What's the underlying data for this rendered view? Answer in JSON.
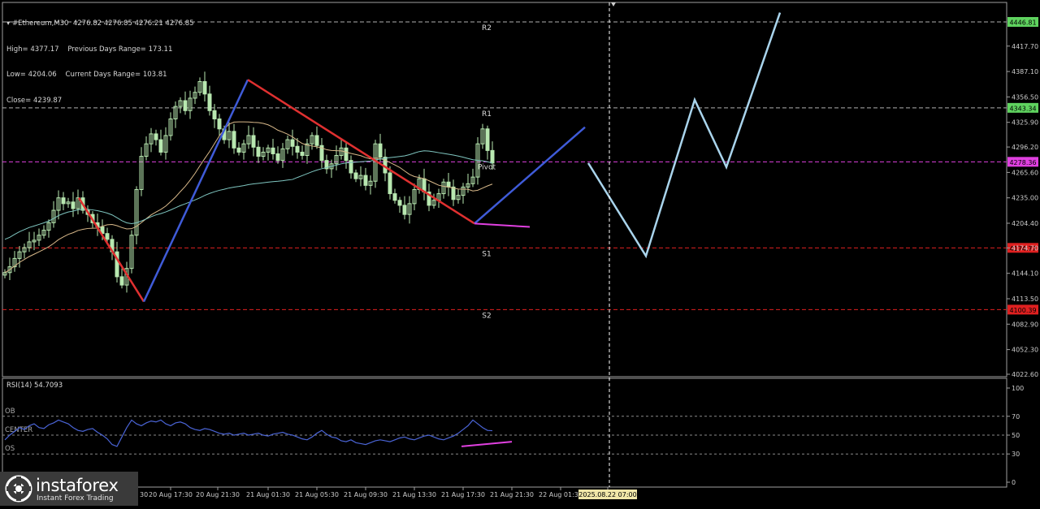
{
  "header": {
    "symbol_line": "#Ethereum,M30  4276.82 4276.85 4276.21 4276.85",
    "high": "High= 4377.17",
    "prev_range": "Previous Days Range= 173.11",
    "low": "Low= 4204.06",
    "curr_range": "Current Days Range= 103.81",
    "close": "Close= 4239.87"
  },
  "branding": {
    "name": "instaforex",
    "tagline": "Instant Forex Trading"
  },
  "colors": {
    "background": "#000000",
    "bull_candle": "#b8e8b0",
    "bear_candle": "#b8e8b0",
    "ma_fast": "#d9b98a",
    "ma_slow": "#7fc6c0",
    "zigzag_up": "#3f5bd8",
    "zigzag_down": "#e03030",
    "projection": "#a9d4ec",
    "divergence": "#e040e0",
    "rsi_line": "#4a64d6",
    "pivot_line": "#e040e0",
    "support_line": "#e02020",
    "resistance_line": "#b0b0b0",
    "price_badge_green": "#5fd35f",
    "price_badge_red": "#e02020",
    "price_badge_magenta": "#e040e0"
  },
  "chart_data": [
    {
      "type": "line",
      "title": "#Ethereum,M30",
      "y_axis_ticks": [
        "4446.81",
        "4417.70",
        "4387.10",
        "4356.50",
        "4325.90",
        "4296.20",
        "4265.60",
        "4235.00",
        "4204.40",
        "4174.70",
        "4144.10",
        "4113.50",
        "4082.90",
        "4052.30",
        "4022.60"
      ],
      "ylim": [
        4022.6,
        4446.81
      ],
      "x_axis_ticks": [
        "20 Aug 17:30",
        "20 Aug 21:30",
        "21 Aug 01:30",
        "21 Aug 05:30",
        "21 Aug 09:30",
        "21 Aug 13:30",
        "21 Aug 17:30",
        "21 Aug 21:30",
        "22 Aug 01:30",
        "2025.08.22 07:00"
      ],
      "levels": [
        {
          "name": "R2",
          "value": 4446.81,
          "badge": "4446.81"
        },
        {
          "name": "R1",
          "value": 4343.34,
          "badge": "4343.34"
        },
        {
          "name": "Pivot",
          "value": 4278.36,
          "badge": "4278.36"
        },
        {
          "name": "S1",
          "value": 4174.77,
          "badge": "4174.77"
        },
        {
          "name": "S2",
          "value": 4100.39,
          "badge": "4100.39"
        }
      ],
      "zigzag_points": [
        {
          "time": "20 Aug 11:30",
          "price": 4235
        },
        {
          "time": "20 Aug 15:00",
          "price": 4110
        },
        {
          "time": "21 Aug 00:00",
          "price": 4377.17
        },
        {
          "time": "21 Aug 17:00",
          "price": 4204.06
        },
        {
          "time": "22 Aug 06:30",
          "price": 4320
        }
      ],
      "projection_points": [
        {
          "step": 0,
          "price": 4276.85
        },
        {
          "step": 1,
          "price": 4165
        },
        {
          "step": 2,
          "price": 4353
        },
        {
          "step": 3,
          "price": 4272
        },
        {
          "step": 4,
          "price": 4458
        }
      ],
      "candles_close": [
        4145,
        4152,
        4162,
        4170,
        4175,
        4182,
        4184,
        4190,
        4196,
        4205,
        4220,
        4235,
        4228,
        4230,
        4222,
        4235,
        4220,
        4215,
        4205,
        4200,
        4192,
        4185,
        4170,
        4140,
        4130,
        4150,
        4190,
        4245,
        4285,
        4300,
        4312,
        4305,
        4290,
        4310,
        4330,
        4345,
        4352,
        4340,
        4355,
        4362,
        4375,
        4360,
        4340,
        4330,
        4318,
        4305,
        4315,
        4295,
        4290,
        4300,
        4310,
        4296,
        4285,
        4290,
        4295,
        4288,
        4280,
        4294,
        4305,
        4297,
        4290,
        4286,
        4300,
        4310,
        4298,
        4280,
        4270,
        4276,
        4286,
        4295,
        4280,
        4265,
        4258,
        4262,
        4250,
        4255,
        4300,
        4284,
        4265,
        4240,
        4232,
        4226,
        4215,
        4228,
        4245,
        4258,
        4242,
        4226,
        4232,
        4240,
        4254,
        4248,
        4233,
        4238,
        4248,
        4252,
        4260,
        4300,
        4318,
        4292,
        4276.85
      ]
    },
    {
      "type": "line",
      "title": "RSI(14) 54.7093",
      "y_axis_ticks": [
        "100",
        "70",
        "50",
        "30",
        "0"
      ],
      "ylim": [
        0,
        100
      ],
      "band_labels": [
        "OB",
        "CENTER",
        "OS"
      ],
      "series": [
        {
          "name": "RSI(14)",
          "values": [
            45,
            50,
            54,
            58,
            56,
            60,
            62,
            58,
            57,
            61,
            63,
            66,
            64,
            62,
            58,
            55,
            54,
            56,
            57,
            53,
            50,
            46,
            40,
            38,
            48,
            58,
            66,
            62,
            60,
            63,
            65,
            64,
            66,
            62,
            60,
            63,
            64,
            62,
            58,
            56,
            55,
            57,
            56,
            54,
            52,
            51,
            52,
            50,
            51,
            52,
            50,
            51,
            52,
            50,
            49,
            51,
            52,
            53,
            51,
            50,
            48,
            46,
            45,
            48,
            52,
            55,
            51,
            48,
            47,
            44,
            43,
            45,
            42,
            41,
            40,
            42,
            44,
            45,
            44,
            43,
            45,
            47,
            48,
            46,
            45,
            47,
            49,
            50,
            48,
            46,
            45,
            47,
            49,
            52,
            56,
            60,
            66,
            62,
            58,
            55,
            54.7
          ]
        }
      ],
      "divergence": [
        {
          "from": 38,
          "to": 43
        }
      ]
    }
  ]
}
